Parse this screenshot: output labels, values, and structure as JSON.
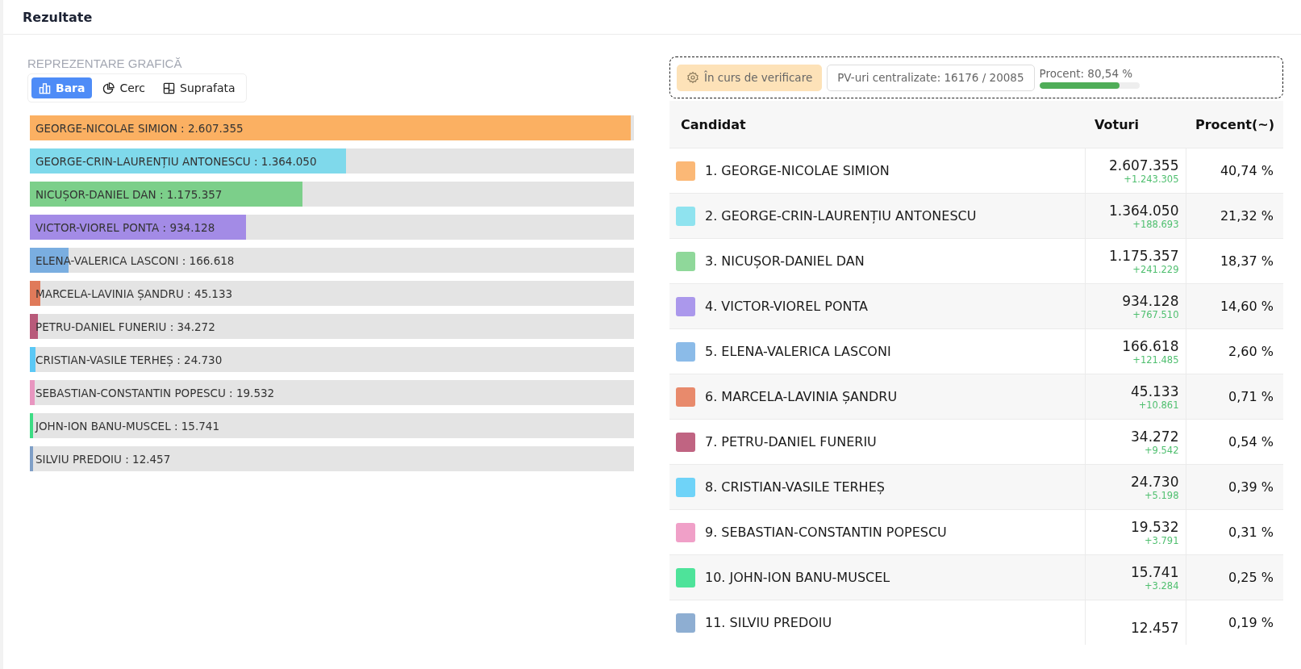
{
  "header": {
    "title": "Rezultate"
  },
  "chart_section": {
    "title": "REPREZENTARE GRAFICĂ"
  },
  "view_tabs": [
    {
      "label": "Bara",
      "kind": "bar",
      "selected": true
    },
    {
      "label": "Cerc",
      "kind": "pie",
      "selected": false
    },
    {
      "label": "Suprafata",
      "kind": "area",
      "selected": false
    }
  ],
  "bars": [
    {
      "label": "GEORGE-NICOLAE SIMION : 2.607.355",
      "level": 1,
      "color": "#fbb062"
    },
    {
      "label": "GEORGE-CRIN-LAURENȚIU ANTONESCU : 1.364.050",
      "level": 0.523,
      "color": "#7fd9eb"
    },
    {
      "label": "NICUȘOR-DANIEL DAN : 1.175.357",
      "level": 0.451,
      "color": "#7ccf8a"
    },
    {
      "label": "VICTOR-VIOREL PONTA : 934.128",
      "level": 0.358,
      "color": "#a38be6"
    },
    {
      "label": "ELENA-VALERICA LASCONI : 166.618",
      "level": 0.064,
      "color": "#7aaee0"
    },
    {
      "label": "MARCELA-LAVINIA ȘANDRU : 45.133",
      "level": 0.017,
      "color": "#e07a5a"
    },
    {
      "label": "PETRU-DANIEL FUNERIU : 34.272",
      "level": 0.013,
      "color": "#b85a7a"
    },
    {
      "label": "CRISTIAN-VASILE TERHEȘ : 24.730",
      "level": 0.0095,
      "color": "#5bc8f5"
    },
    {
      "label": "SEBASTIAN-CONSTANTIN POPESCU : 19.532",
      "level": 0.0075,
      "color": "#e896c0"
    },
    {
      "label": "JOHN-ION BANU-MUSCEL : 15.741",
      "level": 0.006,
      "color": "#3ddc84"
    },
    {
      "label": "SILVIU PREDOIU : 12.457",
      "level": 0.0048,
      "color": "#7f9fc7"
    }
  ],
  "status": {
    "badge": "În curs de verificare",
    "counted": "PV-uri centralizate: 16176 / 20085",
    "progress_label": "Procent: 80,54 %",
    "level": 0.8054
  },
  "table": {
    "columns": [
      "Candidat",
      "Voturi",
      "Procent(~)"
    ],
    "rows": [
      {
        "name": "1. GEORGE-NICOLAE SIMION",
        "votes": "2.607.355",
        "delta": "+1.243.305",
        "percent": "40,74 %",
        "color": "#fbb876"
      },
      {
        "name": "2. GEORGE-CRIN-LAURENȚIU ANTONESCU",
        "votes": "1.364.050",
        "delta": "+188.693",
        "percent": "21,32 %",
        "color": "#8fe3ef"
      },
      {
        "name": "3. NICUȘOR-DANIEL DAN",
        "votes": "1.175.357",
        "delta": "+241.229",
        "percent": "18,37 %",
        "color": "#8fd89a"
      },
      {
        "name": "4. VICTOR-VIOREL PONTA",
        "votes": "934.128",
        "delta": "+767.510",
        "percent": "14,60 %",
        "color": "#ab98ec"
      },
      {
        "name": "5. ELENA-VALERICA LASCONI",
        "votes": "166.618",
        "delta": "+121.485",
        "percent": "2,60 %",
        "color": "#8bbbe8"
      },
      {
        "name": "6. MARCELA-LAVINIA ȘANDRU",
        "votes": "45.133",
        "delta": "+10.861",
        "percent": "0,71 %",
        "color": "#e88a6c"
      },
      {
        "name": "7. PETRU-DANIEL FUNERIU",
        "votes": "34.272",
        "delta": "+9.542",
        "percent": "0,54 %",
        "color": "#c06482"
      },
      {
        "name": "8. CRISTIAN-VASILE TERHEȘ",
        "votes": "24.730",
        "delta": "+5.198",
        "percent": "0,39 %",
        "color": "#6fd3f8"
      },
      {
        "name": "9. SEBASTIAN-CONSTANTIN POPESCU",
        "votes": "19.532",
        "delta": "+3.791",
        "percent": "0,31 %",
        "color": "#f0a0c8"
      },
      {
        "name": "10. JOHN-ION BANU-MUSCEL",
        "votes": "15.741",
        "delta": "+3.284",
        "percent": "0,25 %",
        "color": "#4ee39a"
      },
      {
        "name": "11. SILVIU PREDOIU",
        "votes": "12.457",
        "percent": "0,19 %",
        "color": "#8eaed2"
      }
    ]
  }
}
